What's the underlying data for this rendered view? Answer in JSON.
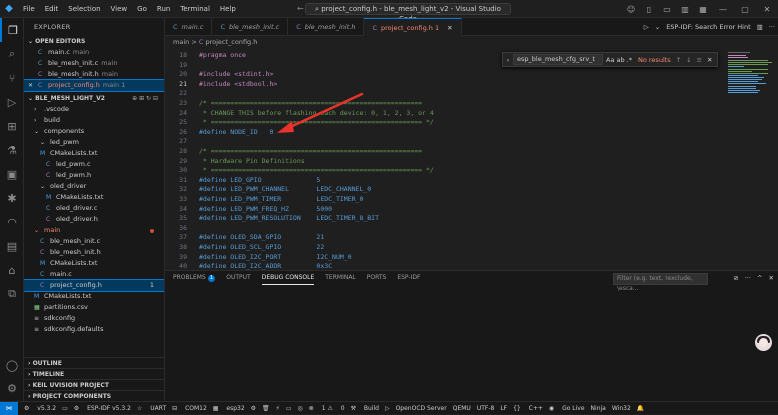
{
  "window": {
    "title": "project_config.h - ble_mesh_light_v2 - Visual Studio Code"
  },
  "menu": [
    "File",
    "Edit",
    "Selection",
    "View",
    "Go",
    "Run",
    "Terminal",
    "Help"
  ],
  "sidebar": {
    "title": "EXPLORER",
    "open_editors_header": "OPEN EDITORS",
    "open_editors": [
      {
        "icon": "C",
        "name": "main.c",
        "desc": "main"
      },
      {
        "icon": "C",
        "name": "ble_mesh_init.c",
        "desc": "main"
      },
      {
        "icon": "C",
        "name": "ble_mesh_init.h",
        "desc": "main"
      },
      {
        "icon": "C",
        "name": "project_config.h",
        "desc": "main 1"
      }
    ],
    "project_header": "BLE_MESH_LIGHT_V2",
    "tree": [
      {
        "icon": "›",
        "name": ".vscode"
      },
      {
        "icon": "›",
        "name": "build"
      },
      {
        "icon": "⌄",
        "name": "components"
      },
      {
        "icon": "⌄",
        "name": "led_pwm"
      },
      {
        "icon": "M",
        "name": "CMakeLists.txt"
      },
      {
        "icon": "C",
        "name": "led_pwm.c"
      },
      {
        "icon": "C",
        "name": "led_pwm.h"
      },
      {
        "icon": "⌄",
        "name": "oled_driver"
      },
      {
        "icon": "M",
        "name": "CMakeLists.txt"
      },
      {
        "icon": "C",
        "name": "oled_driver.c"
      },
      {
        "icon": "C",
        "name": "oled_driver.h"
      },
      {
        "icon": "⌄",
        "name": "main"
      },
      {
        "icon": "C",
        "name": "ble_mesh_init.c"
      },
      {
        "icon": "C",
        "name": "ble_mesh_init.h"
      },
      {
        "icon": "M",
        "name": "CMakeLists.txt"
      },
      {
        "icon": "C",
        "name": "main.c"
      },
      {
        "icon": "C",
        "name": "project_config.h",
        "badge": "1"
      },
      {
        "icon": "M",
        "name": "CMakeLists.txt"
      },
      {
        "icon": "▦",
        "name": "partitions.csv"
      },
      {
        "icon": "≡",
        "name": "sdkconfig"
      },
      {
        "icon": "≡",
        "name": "sdkconfig.defaults"
      }
    ],
    "bottom_sections": [
      "OUTLINE",
      "TIMELINE",
      "KEIL UVISION PROJECT",
      "PROJECT COMPONENTS"
    ]
  },
  "tabs": [
    {
      "icon": "C",
      "label": "main.c",
      "active": false
    },
    {
      "icon": "C",
      "label": "ble_mesh_init.c",
      "active": false
    },
    {
      "icon": "C",
      "label": "ble_mesh_init.h",
      "active": false
    },
    {
      "icon": "C",
      "label": "project_config.h 1",
      "active": true
    }
  ],
  "tab_actions": {
    "search_hint": "ESP-IDF: Search Error Hint"
  },
  "breadcrumb": {
    "folder": "main",
    "sep": ">",
    "file": "project_config.h"
  },
  "find_widget": {
    "value": "esp_ble_mesh_cfg_srv_t",
    "options": "Aa ab .*",
    "result": "No results"
  },
  "editor": {
    "lines": [
      {
        "n": "18",
        "t": "#pragma once"
      },
      {
        "n": "19",
        "t": ""
      },
      {
        "n": "20",
        "t": "#include <stdint.h>"
      },
      {
        "n": "21",
        "t": "#include <stdbool.h>"
      },
      {
        "n": "22",
        "t": ""
      },
      {
        "n": "23",
        "t": "/* ======================================================"
      },
      {
        "n": "24",
        "t": " * CHANGE THIS before flashing each device: 0, 1, 2, 3, or 4"
      },
      {
        "n": "25",
        "t": " * ====================================================== */"
      },
      {
        "n": "26",
        "t": "#define NODE_ID   0"
      },
      {
        "n": "27",
        "t": ""
      },
      {
        "n": "28",
        "t": "/* ======================================================"
      },
      {
        "n": "29",
        "t": " * Hardware Pin Definitions"
      },
      {
        "n": "30",
        "t": " * ====================================================== */"
      },
      {
        "n": "31",
        "t": "#define LED_GPIO              5"
      },
      {
        "n": "32",
        "t": "#define LED_PWM_CHANNEL       LEDC_CHANNEL_0"
      },
      {
        "n": "33",
        "t": "#define LED_PWM_TIMER         LEDC_TIMER_0"
      },
      {
        "n": "34",
        "t": "#define LED_PWM_FREQ_HZ       5000"
      },
      {
        "n": "35",
        "t": "#define LED_PWM_RESOLUTION    LEDC_TIMER_8_BIT"
      },
      {
        "n": "36",
        "t": ""
      },
      {
        "n": "37",
        "t": "#define OLED_SDA_GPIO         21"
      },
      {
        "n": "38",
        "t": "#define OLED_SCL_GPIO         22"
      },
      {
        "n": "39",
        "t": "#define OLED_I2C_PORT         I2C_NUM_0"
      },
      {
        "n": "40",
        "t": "#define OLED_I2C_ADDR         0x3C"
      }
    ],
    "current_line": "21"
  },
  "panel": {
    "tabs": [
      "PROBLEMS",
      "OUTPUT",
      "DEBUG CONSOLE",
      "TERMINAL",
      "PORTS",
      "ESP-IDF"
    ],
    "problems_count": "1",
    "active": "DEBUG CONSOLE",
    "filter_placeholder": "Filter (e.g. text, !exclude, \\esca..."
  },
  "status": {
    "idf_version": "v5.3.2",
    "esp_idf": "ESP-IDF v5.3.2",
    "uart": "UART",
    "com": "COM12",
    "target": "esp32",
    "errors": "1",
    "warnings": "0",
    "build": "Build",
    "openocd": "OpenOCD Server",
    "qemu": "QEMU",
    "encoding": "UTF-8",
    "eol": "LF",
    "language": "C++",
    "golive": "Go Live",
    "ninja": "Ninja",
    "platform": "Win32"
  },
  "colors": {
    "accent": "#0078d4",
    "arrow": "#e8332a",
    "error": "#f48771"
  }
}
